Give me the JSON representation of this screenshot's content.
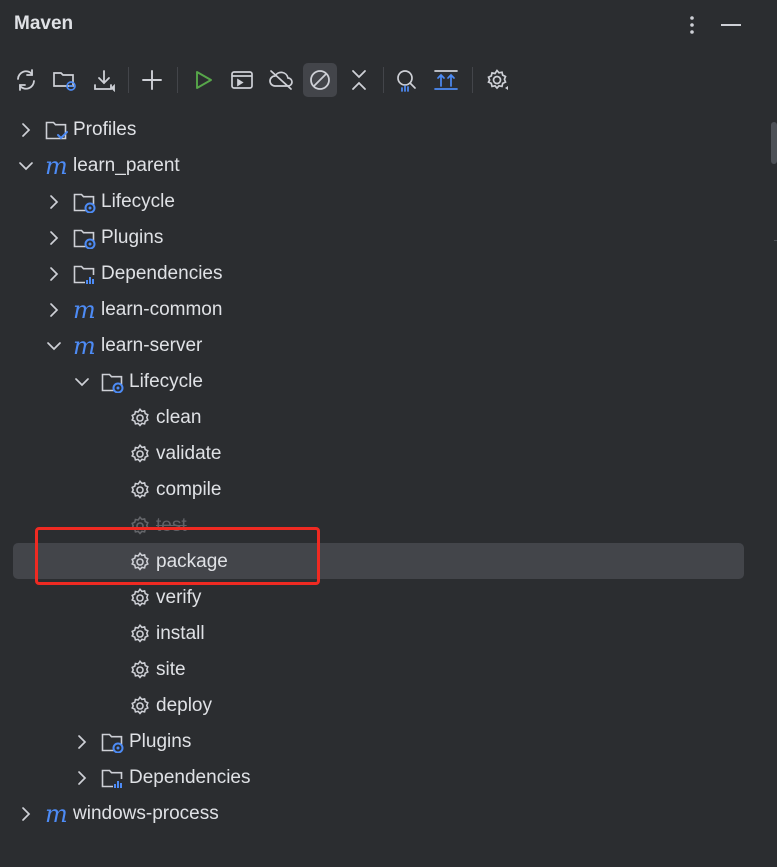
{
  "panel": {
    "title": "Maven"
  },
  "header_actions": [
    {
      "name": "more-options-icon"
    },
    {
      "name": "hide-panel-icon"
    }
  ],
  "toolbar": {
    "buttons": [
      "reload-icon",
      "generate-sources-icon",
      "download-icon",
      "add-icon",
      "run-icon",
      "execute-goal-icon",
      "offline-mode-icon",
      "skip-tests-icon",
      "collapse-all-icon",
      "analyze-dependencies-icon",
      "show-dependencies-icon",
      "settings-icon"
    ],
    "active": "skip-tests-icon"
  },
  "tree": [
    {
      "label": "Profiles",
      "level": 0,
      "icon": "profiles-folder-icon",
      "expanded": false
    },
    {
      "label": "learn_parent",
      "level": 0,
      "icon": "maven-project-icon",
      "expanded": true
    },
    {
      "label": "Lifecycle",
      "level": 1,
      "icon": "lifecycle-folder-icon",
      "expanded": false
    },
    {
      "label": "Plugins",
      "level": 1,
      "icon": "plugins-folder-icon",
      "expanded": false
    },
    {
      "label": "Dependencies",
      "level": 1,
      "icon": "dependencies-folder-icon",
      "expanded": false
    },
    {
      "label": "learn-common",
      "level": 1,
      "icon": "maven-project-icon",
      "expanded": false
    },
    {
      "label": "learn-server",
      "level": 1,
      "icon": "maven-project-icon",
      "expanded": true
    },
    {
      "label": "Lifecycle",
      "level": 2,
      "icon": "lifecycle-folder-icon",
      "expanded": true
    },
    {
      "label": "clean",
      "level": 3,
      "icon": "gear-icon"
    },
    {
      "label": "validate",
      "level": 3,
      "icon": "gear-icon"
    },
    {
      "label": "compile",
      "level": 3,
      "icon": "gear-icon"
    },
    {
      "label": "test",
      "level": 3,
      "icon": "gear-icon",
      "disabled": true
    },
    {
      "label": "package",
      "level": 3,
      "icon": "gear-icon",
      "selected": true
    },
    {
      "label": "verify",
      "level": 3,
      "icon": "gear-icon"
    },
    {
      "label": "install",
      "level": 3,
      "icon": "gear-icon"
    },
    {
      "label": "site",
      "level": 3,
      "icon": "gear-icon"
    },
    {
      "label": "deploy",
      "level": 3,
      "icon": "gear-icon"
    },
    {
      "label": "Plugins",
      "level": 2,
      "icon": "plugins-folder-icon",
      "expanded": false
    },
    {
      "label": "Dependencies",
      "level": 2,
      "icon": "dependencies-folder-icon",
      "expanded": false
    },
    {
      "label": "windows-process",
      "level": 0,
      "icon": "maven-project-icon",
      "expanded": false
    }
  ],
  "colors": {
    "background": "#2b2d30",
    "selection": "#43454a",
    "accent_blue": "#4d8bf5",
    "run_green": "#57a64a",
    "highlight_box": "#ef2a22"
  }
}
